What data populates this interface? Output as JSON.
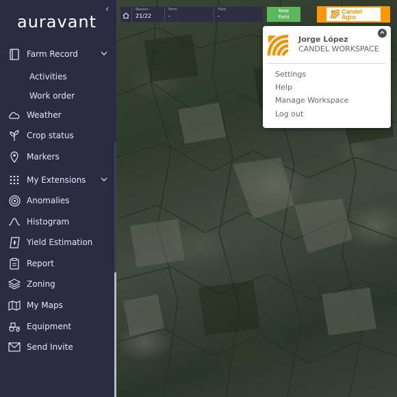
{
  "sidebar": {
    "logo": "auravant",
    "collapse_icon": "‹",
    "items": [
      {
        "label": "Farm Record",
        "icon": "notebook-icon"
      },
      {
        "label": "Weather",
        "icon": "cloud-icon"
      },
      {
        "label": "Crop status",
        "icon": "plant-icon"
      },
      {
        "label": "Markers",
        "icon": "pin-icon"
      },
      {
        "label": "My Extensions",
        "icon": "grid-icon"
      },
      {
        "label": "Anomalies",
        "icon": "target-icon"
      },
      {
        "label": "Histogram",
        "icon": "bell-curve-icon"
      },
      {
        "label": "Yield Estimation",
        "icon": "yield-icon"
      },
      {
        "label": "Report",
        "icon": "clipboard-icon"
      },
      {
        "label": "Zoning",
        "icon": "layers-icon"
      },
      {
        "label": "My Maps",
        "icon": "map-icon"
      },
      {
        "label": "Equipment",
        "icon": "tractor-icon"
      },
      {
        "label": "Send Invite",
        "icon": "envelope-icon"
      }
    ],
    "farm_record_sub": [
      "Activities",
      "Work order"
    ]
  },
  "topbar": {
    "season_label": "Season:",
    "season_value": "21/22",
    "farm_label": "Farm:",
    "farm_value": "-",
    "field_label": "Field:",
    "field_value": "-",
    "new_field_line1": "New",
    "new_field_line2": "Field",
    "brand_line1": "Candel",
    "brand_line2": "Agro",
    "brand_color": "#ff9800",
    "new_field_color": "#5cb85c"
  },
  "dropdown": {
    "name": "Jorge López",
    "workspace": "CANDEL WORKSPACE",
    "items": [
      "Settings",
      "Help",
      "Manage Workspace",
      "Log out"
    ]
  }
}
